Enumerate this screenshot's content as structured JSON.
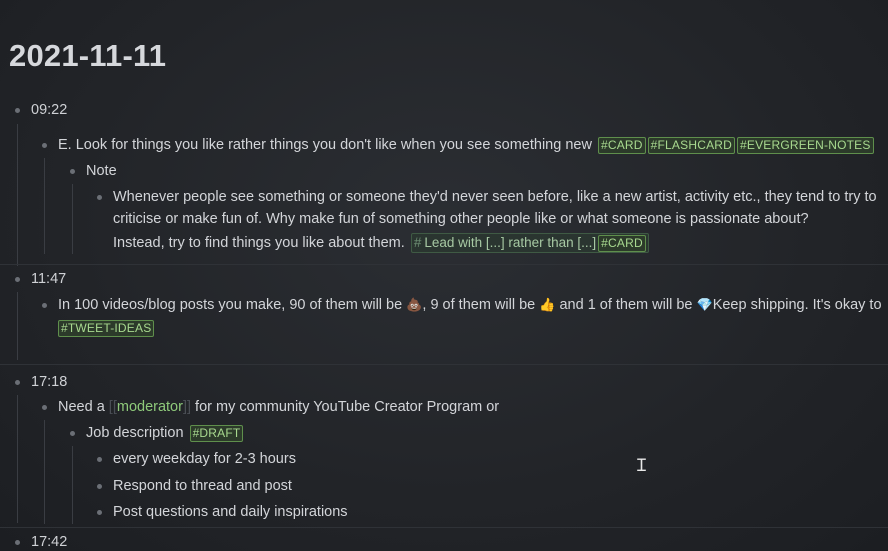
{
  "page": {
    "title": "2021-11-11"
  },
  "blocks": {
    "b0922": {
      "time": "09:22",
      "item1": {
        "text": "E. Look for things you like rather things you don't like when you see something new",
        "tags": [
          "#CARD",
          "#FLASHCARD",
          "#EVERGREEN-NOTES"
        ]
      },
      "note": {
        "label": "Note"
      },
      "note_text": {
        "line1": "Whenever people see something or someone they'd never seen before, like a new artist, activity etc., they tend to try to",
        "line2": "criticise or make fun of. Why make fun of something other people like or what someone is passionate about?",
        "line3": "Instead, try to find things you like about them.",
        "ref_hash": "#",
        "ref_text": "Lead with [...] rather than [...]",
        "ref_tag": "#CARD"
      }
    },
    "b1147": {
      "time": "11:47",
      "text_a": "In 100 videos/blog posts you make, 90 of them will be",
      "emoji_a": "💩",
      "text_b": ", 9 of them will be",
      "emoji_b": "👍",
      "text_c": "and 1 of them will be",
      "emoji_c": "💎",
      "text_d": "Keep shipping. It's okay to",
      "tag": "#TWEET-IDEAS"
    },
    "b1718": {
      "time": "17:18",
      "need_prefix": "Need a",
      "bracket_open": "[[",
      "link": "moderator",
      "bracket_close": "]]",
      "need_suffix": "for my community YouTube Creator Program or",
      "job_desc": "Job description",
      "job_tag": "#DRAFT",
      "items": [
        "every weekday for 2-3 hours",
        "Respond to thread and post",
        "Post questions and daily inspirations"
      ]
    },
    "b1742": {
      "time": "17:42"
    }
  }
}
